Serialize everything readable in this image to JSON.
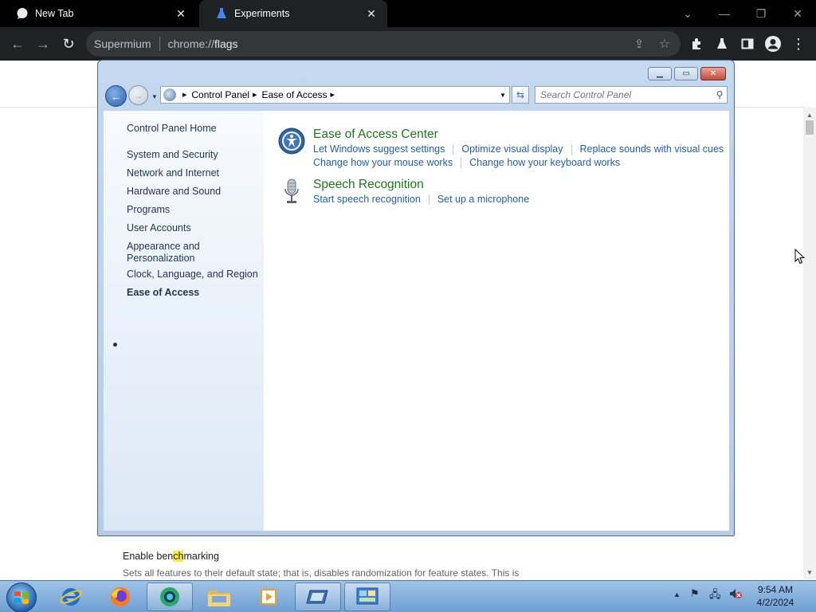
{
  "browser": {
    "tabs": [
      {
        "title": "New Tab",
        "favicon": "chat-bubble-icon",
        "active": false
      },
      {
        "title": "Experiments",
        "favicon": "flask-icon",
        "active": true
      }
    ],
    "omnibox": {
      "site_name": "Supermium",
      "url_prefix": "chrome://",
      "url_host": "flags"
    }
  },
  "page": {
    "flag_title_pre": "Enable ben",
    "flag_title_hl": "ch",
    "flag_title_post": "marking",
    "flag_description": "Sets all features to their default state; that is, disables randomization for feature states. This is"
  },
  "control_panel": {
    "breadcrumb": [
      "Control Panel",
      "Ease of Access"
    ],
    "search_placeholder": "Search Control Panel",
    "sidebar": {
      "home": "Control Panel Home",
      "items": [
        "System and Security",
        "Network and Internet",
        "Hardware and Sound",
        "Programs",
        "User Accounts",
        "Appearance and",
        "Personalization",
        "Clock, Language, and Region",
        "Ease of Access"
      ]
    },
    "categories": [
      {
        "title": "Ease of Access Center",
        "icon": "ease-of-access-icon",
        "tasks": [
          "Let Windows suggest settings",
          "Optimize visual display",
          "Replace sounds with visual cues",
          "Change how your mouse works",
          "Change how your keyboard works"
        ]
      },
      {
        "title": "Speech Recognition",
        "icon": "microphone-icon",
        "tasks": [
          "Start speech recognition",
          "Set up a microphone"
        ]
      }
    ]
  },
  "taskbar": {
    "pinned": [
      "internet-explorer-icon",
      "firefox-icon",
      "supermium-icon",
      "file-explorer-icon",
      "media-player-icon",
      "window-switcher-icon",
      "control-panel-icon"
    ],
    "clock_time": "9:54 AM",
    "clock_date": "4/2/2024"
  },
  "colors": {
    "link_blue": "#1e5fb3",
    "category_green": "#1a7a1a",
    "browser_bg": "#202124"
  }
}
